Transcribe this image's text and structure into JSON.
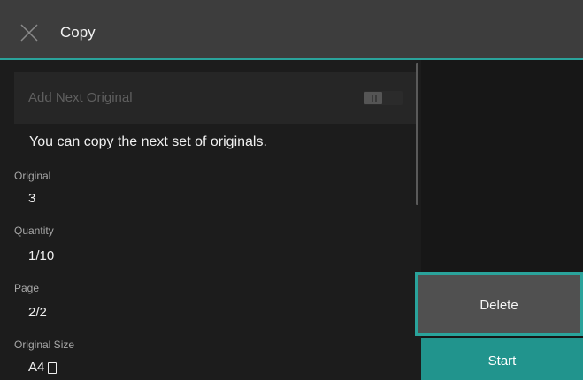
{
  "header": {
    "title": "Copy",
    "close_icon": "close-icon"
  },
  "add_next": {
    "label": "Add Next Original",
    "enabled": false,
    "toggle_state": "off"
  },
  "info_text": "You can copy the next set of originals.",
  "fields": {
    "original": {
      "label": "Original",
      "value": "3"
    },
    "quantity": {
      "label": "Quantity",
      "value": "1/10"
    },
    "page": {
      "label": "Page",
      "value": "2/2"
    },
    "original_size": {
      "label": "Original Size",
      "value": "A4",
      "orientation_icon": "portrait-page-icon"
    }
  },
  "buttons": {
    "delete_label": "Delete",
    "start_label": "Start"
  },
  "colors": {
    "accent": "#2aa39b",
    "start_bg": "#21948d",
    "header_bg": "#3d3d3d",
    "body_bg": "#1c1c1c"
  }
}
